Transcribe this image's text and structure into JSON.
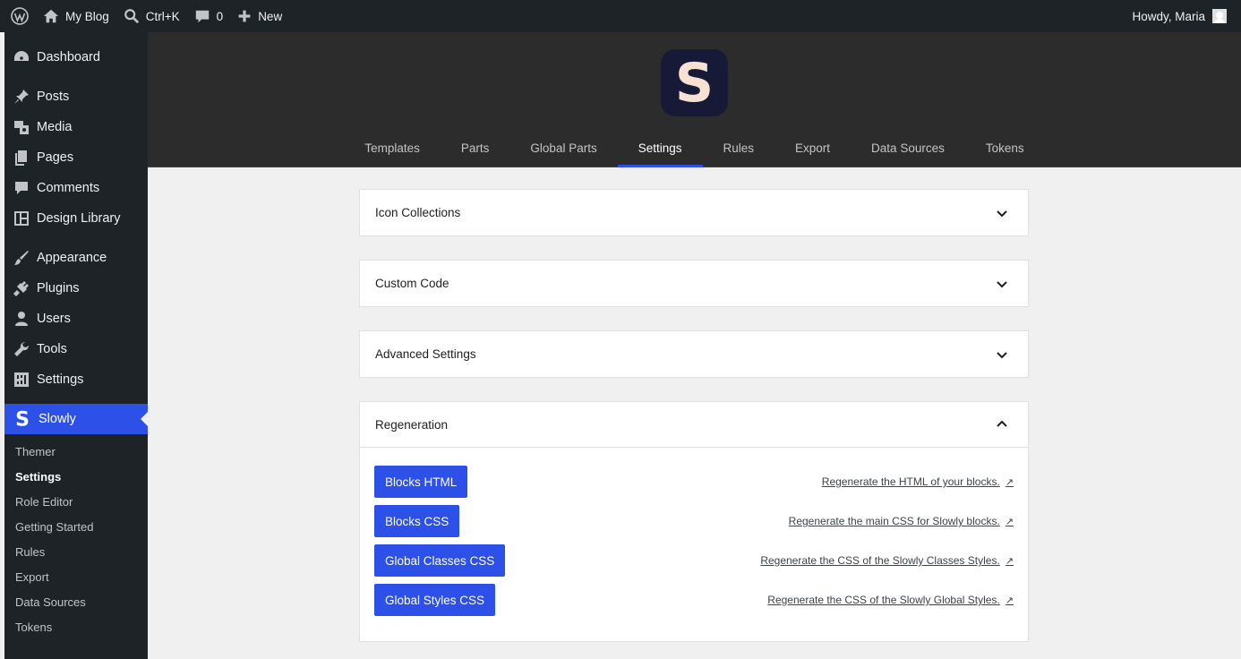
{
  "adminbar": {
    "site_name": "My Blog",
    "search_shortcut": "Ctrl+K",
    "comments_count": "0",
    "new_label": "New",
    "howdy": "Howdy, Maria"
  },
  "sidebar": {
    "items": [
      {
        "label": "Dashboard",
        "icon": "dashboard-icon"
      },
      {
        "label": "Posts",
        "icon": "pin-icon"
      },
      {
        "label": "Media",
        "icon": "media-icon"
      },
      {
        "label": "Pages",
        "icon": "pages-icon"
      },
      {
        "label": "Comments",
        "icon": "comment-icon"
      },
      {
        "label": "Design Library",
        "icon": "layout-icon"
      },
      {
        "label": "Appearance",
        "icon": "brush-icon"
      },
      {
        "label": "Plugins",
        "icon": "plug-icon"
      },
      {
        "label": "Users",
        "icon": "user-icon"
      },
      {
        "label": "Tools",
        "icon": "wrench-icon"
      },
      {
        "label": "Settings",
        "icon": "settings-icon"
      },
      {
        "label": "Slowly",
        "icon": "slowly-s-icon"
      }
    ],
    "submenu": [
      "Themer",
      "Settings",
      "Role Editor",
      "Getting Started",
      "Rules",
      "Export",
      "Data Sources",
      "Tokens"
    ]
  },
  "header": {
    "logo_letter": "S",
    "tabs": [
      "Templates",
      "Parts",
      "Global Parts",
      "Settings",
      "Rules",
      "Export",
      "Data Sources",
      "Tokens"
    ],
    "active_tab": "Settings"
  },
  "panels": {
    "icon_collections": "Icon Collections",
    "custom_code": "Custom Code",
    "advanced_settings": "Advanced Settings",
    "regeneration": "Regeneration"
  },
  "regeneration": [
    {
      "button": "Blocks HTML",
      "link": "Regenerate the HTML of your blocks."
    },
    {
      "button": "Blocks CSS",
      "link": "Regenerate the main CSS for Slowly blocks."
    },
    {
      "button": "Global Classes CSS",
      "link": "Regenerate the CSS of the Slowly Classes Styles."
    },
    {
      "button": "Global Styles CSS",
      "link": "Regenerate the CSS of the Slowly Global Styles."
    }
  ],
  "colors": {
    "accent": "#2d51e8",
    "adminbar_bg": "#1d2327",
    "header_bg": "#2c2c2c",
    "logo_bg": "#161a36"
  }
}
